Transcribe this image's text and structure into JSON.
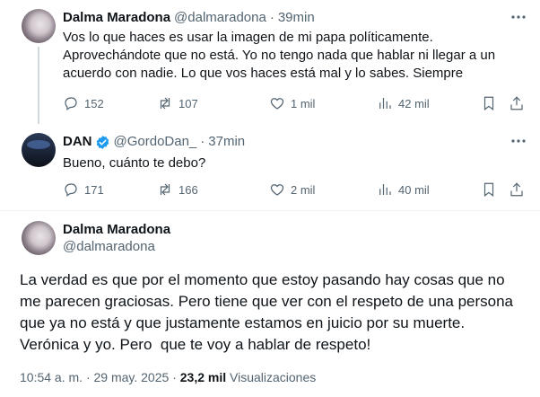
{
  "tweets": [
    {
      "name": "Dalma Maradona",
      "handle": "@dalmaradona",
      "sep": "·",
      "time": "39min",
      "text": "Vos lo que haces es usar la imagen de mi papa políticamente.\nAprovechándote que no está. Yo no tengo nada que hablar ni llegar a un\nacuerdo con nadie. Lo que vos haces está mal y lo sabes. Siempre",
      "replies": "152",
      "retweets": "107",
      "likes": "1 mil",
      "views": "42 mil"
    },
    {
      "name": "DAN",
      "verified": true,
      "handle": "@GordoDan_",
      "sep": "·",
      "time": "37min",
      "text": "Bueno, cuánto te debo?",
      "replies": "171",
      "retweets": "166",
      "likes": "2 mil",
      "views": "40 mil"
    }
  ],
  "main_tweet": {
    "name": "Dalma Maradona",
    "handle": "@dalmaradona",
    "text": "La verdad es que por el momento que estoy pasando hay cosas que no\nme parecen graciosas. Pero tiene que ver con el respeto de una persona\nque ya no está y que justamente estamos en juicio por su muerte.\nVerónica y yo. Pero  que te voy a hablar de respeto!",
    "time": "10:54 a. m.",
    "sep": "·",
    "date": "29 may. 2025",
    "views_count": "23,2 mil",
    "views_label": "Visualizaciones"
  },
  "colors": {
    "text": "#0f1419",
    "secondary": "#536471",
    "verified": "#1d9bf0",
    "divider": "#eff3f4"
  },
  "icons": [
    "reply-icon",
    "retweet-icon",
    "like-icon",
    "views-icon",
    "bookmark-icon",
    "share-icon",
    "more-icon",
    "verified-badge-icon"
  ]
}
